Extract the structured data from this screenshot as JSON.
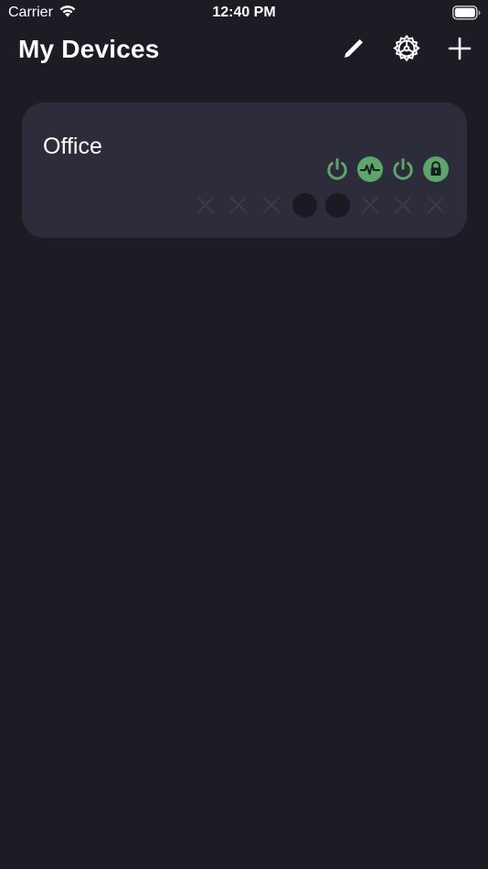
{
  "status_bar": {
    "carrier": "Carrier",
    "time": "12:40 PM"
  },
  "header": {
    "title": "My Devices",
    "actions": [
      {
        "name": "edit",
        "icon": "pencil-icon"
      },
      {
        "name": "settings",
        "icon": "gear-icon"
      },
      {
        "name": "add",
        "icon": "plus-icon"
      }
    ]
  },
  "devices": [
    {
      "name": "Office",
      "status_icons": [
        "power-icon",
        "activity-icon",
        "power-icon",
        "lock-icon"
      ],
      "ports": [
        "inactive",
        "inactive",
        "inactive",
        "active",
        "active",
        "inactive",
        "inactive",
        "inactive"
      ]
    }
  ],
  "colors": {
    "background": "#1c1c24",
    "card": "#2c2c3a",
    "accent_green": "#5ea56b",
    "port_inactive": "#3a3a48",
    "port_active": "#1a1a22"
  }
}
